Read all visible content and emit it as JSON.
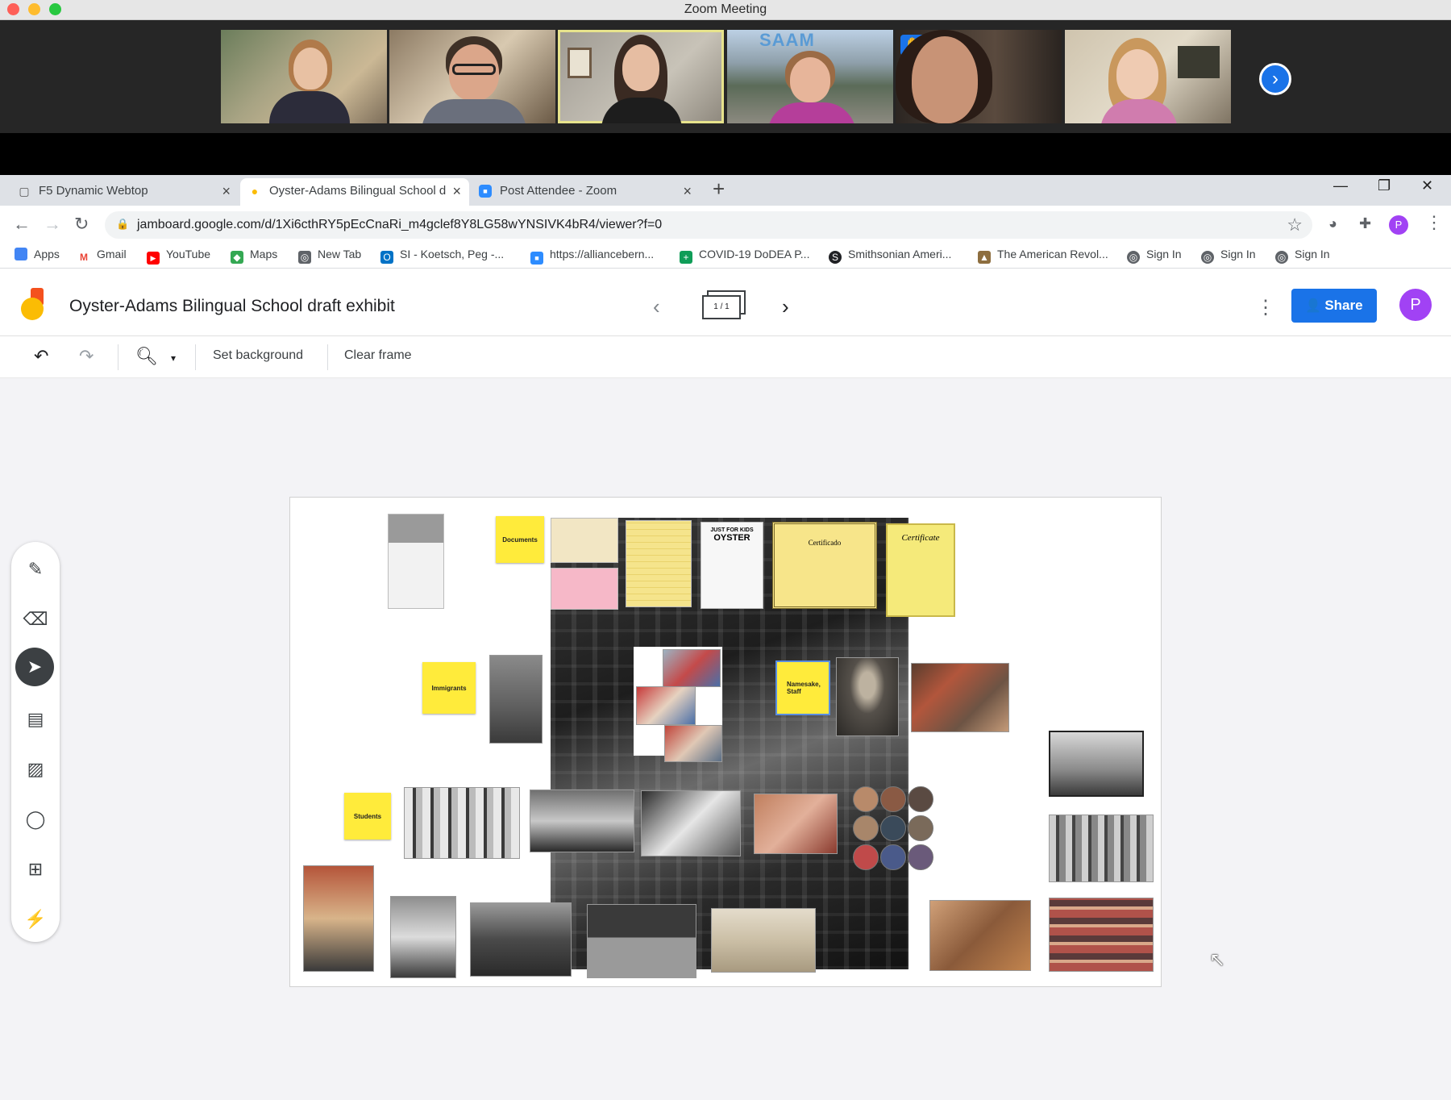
{
  "zoom": {
    "window_title": "Zoom Meeting",
    "next_arrow": "›",
    "raise_hand_icon": "✋",
    "saam_label": "SAAM"
  },
  "browser": {
    "tabs": [
      {
        "label": "F5 Dynamic Webtop",
        "icon": "▢"
      },
      {
        "label": "Oyster-Adams Bilingual School d",
        "icon": "●"
      },
      {
        "label": "Post Attendee - Zoom",
        "icon": "■"
      }
    ],
    "new_tab": "+",
    "url": "jamboard.google.com/d/1Xi6cthRY5pEcCnaRi_m4gclef8Y8LG58wYNSIVK4bR4/viewer?f=0",
    "profile_initial": "P",
    "bookmarks": [
      {
        "label": "Apps",
        "color": "#4285f4",
        "glyph": "⋮"
      },
      {
        "label": "Gmail",
        "color": "#ea4335",
        "glyph": "M"
      },
      {
        "label": "YouTube",
        "color": "#ff0000",
        "glyph": "▶"
      },
      {
        "label": "Maps",
        "color": "#34a853",
        "glyph": "◆"
      },
      {
        "label": "New Tab",
        "color": "#5f6368",
        "glyph": "◎"
      },
      {
        "label": "SI - Koetsch, Peg -...",
        "color": "#0072c6",
        "glyph": "O"
      },
      {
        "label": "https://alliancebern...",
        "color": "#2d8cff",
        "glyph": "■"
      },
      {
        "label": "COVID-19 DoDEA P...",
        "color": "#0f9d58",
        "glyph": "+"
      },
      {
        "label": "Smithsonian Ameri...",
        "color": "#202124",
        "glyph": "S"
      },
      {
        "label": "The American Revol...",
        "color": "#8d6e3f",
        "glyph": "▲"
      },
      {
        "label": "Sign In",
        "color": "#5f6368",
        "glyph": "◎"
      },
      {
        "label": "Sign In",
        "color": "#5f6368",
        "glyph": "◎"
      },
      {
        "label": "Sign In",
        "color": "#5f6368",
        "glyph": "◎"
      }
    ]
  },
  "jamboard": {
    "title": "Oyster-Adams Bilingual School draft exhibit",
    "frame_indicator": "1 / 1",
    "share_label": "Share",
    "profile_initial": "P",
    "toolbar": {
      "set_background": "Set background",
      "clear_frame": "Clear frame"
    },
    "stickies": {
      "documents": "Documents",
      "immigrants": "Immigrants",
      "namesake": "Namesake, Staff",
      "students": "Students"
    },
    "doc_texts": {
      "just_for_kids": "JUST FOR KIDS",
      "oyster": "OYSTER",
      "certificado": "Certificado",
      "certificate": "Certificate"
    }
  },
  "colors": {
    "jam_blue": "#1a73e8",
    "sticky_yellow": "#ffeb3b",
    "profile_purple": "#a142f4"
  }
}
